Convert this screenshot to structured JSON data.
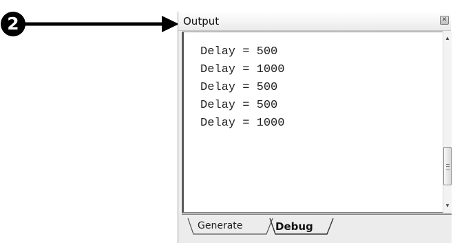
{
  "callout": {
    "number": "2"
  },
  "window": {
    "title": "Output",
    "close_icon": "close-icon"
  },
  "output": {
    "lines": [
      "Delay = 500",
      "Delay = 1000",
      "Delay = 500",
      "Delay = 500",
      "Delay = 1000"
    ]
  },
  "tabs": [
    {
      "label": "Generate",
      "active": false
    },
    {
      "label": "Debug",
      "active": true
    }
  ],
  "colors": {
    "arrow": "#000000",
    "pane_background": "#ffffff"
  }
}
